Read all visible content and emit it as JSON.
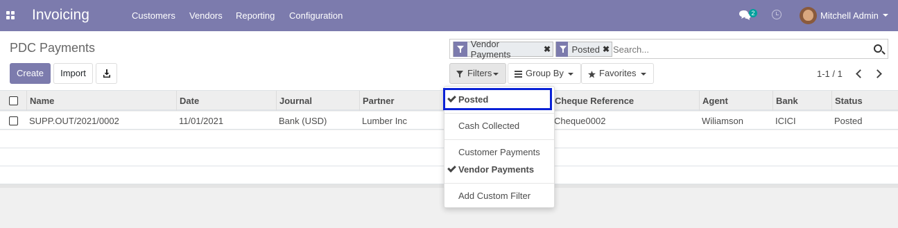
{
  "navbar": {
    "brand": "Invoicing",
    "menu": [
      "Customers",
      "Vendors",
      "Reporting",
      "Configuration"
    ],
    "chat_count": "2",
    "user": "Mitchell Admin"
  },
  "control": {
    "title": "PDC Payments",
    "create": "Create",
    "import": "Import",
    "facets": [
      "Vendor Payments",
      "Posted"
    ],
    "search_placeholder": "Search...",
    "filters": "Filters",
    "group_by": "Group By",
    "favorites": "Favorites",
    "pager": "1-1 / 1"
  },
  "table": {
    "headers": [
      "Name",
      "Date",
      "Journal",
      "Partner",
      "Cheque Reference",
      "Agent",
      "Bank",
      "Status"
    ],
    "rows": [
      {
        "name": "SUPP.OUT/2021/0002",
        "date": "11/01/2021",
        "journal": "Bank (USD)",
        "partner": "Lumber Inc",
        "cheque": "Cheque0002",
        "agent": "Wiliamson",
        "bank": "ICICI",
        "status": "Posted"
      }
    ]
  },
  "filters_menu": {
    "posted": "Posted",
    "cash_collected": "Cash Collected",
    "customer_payments": "Customer Payments",
    "vendor_payments": "Vendor Payments",
    "add_custom": "Add Custom Filter"
  }
}
